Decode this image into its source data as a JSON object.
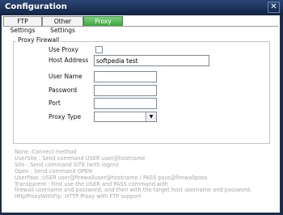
{
  "window": {
    "title": "Configuration",
    "close_label": "✕"
  },
  "tabs": [
    {
      "label": "FTP Settings",
      "active": false
    },
    {
      "label": "Other Settings",
      "active": false
    },
    {
      "label": "Proxy Settings",
      "active": true
    }
  ],
  "proxy": {
    "group_label": "Proxy Firewall",
    "use_proxy_label": "Use Proxy",
    "use_proxy_checked": false,
    "host_label": "Host Address",
    "host_value": "softpedia test",
    "username_label": "User Name",
    "username_value": "",
    "password_label": "Password",
    "password_value": "",
    "port_label": "Port",
    "port_value": "",
    "type_label": "Proxy Type",
    "type_value": ""
  },
  "help_lines": [
    "None :Connect method",
    "UserSite : Send command USER user@hostname",
    "Site : Send command SITE (with logon)",
    "Open : Send command OPEN",
    "UserPass :USER user@firewalluser@hostname / PASS pass@firewallpass",
    "Transparent : First use the USER and PASS command with",
    "firewall username and password, and then with the target host username and password.",
    "HttpProxyWithFtp :HTTP Proxy with FTP support"
  ]
}
